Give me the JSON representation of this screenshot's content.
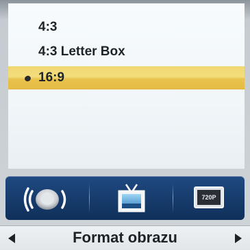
{
  "menu": {
    "options": [
      {
        "label": "4:3",
        "selected": false
      },
      {
        "label": "4:3 Letter Box",
        "selected": false
      },
      {
        "label": "16:9",
        "selected": true
      }
    ]
  },
  "icon_bar": {
    "items": [
      {
        "icon": "sound-icon"
      },
      {
        "icon": "tv-picture-icon"
      },
      {
        "icon": "720p-icon",
        "label": "720P"
      }
    ]
  },
  "footer": {
    "title": "Format obrazu"
  },
  "colors": {
    "highlight": "#f0d873",
    "icon_bar": "#1f4a82"
  }
}
